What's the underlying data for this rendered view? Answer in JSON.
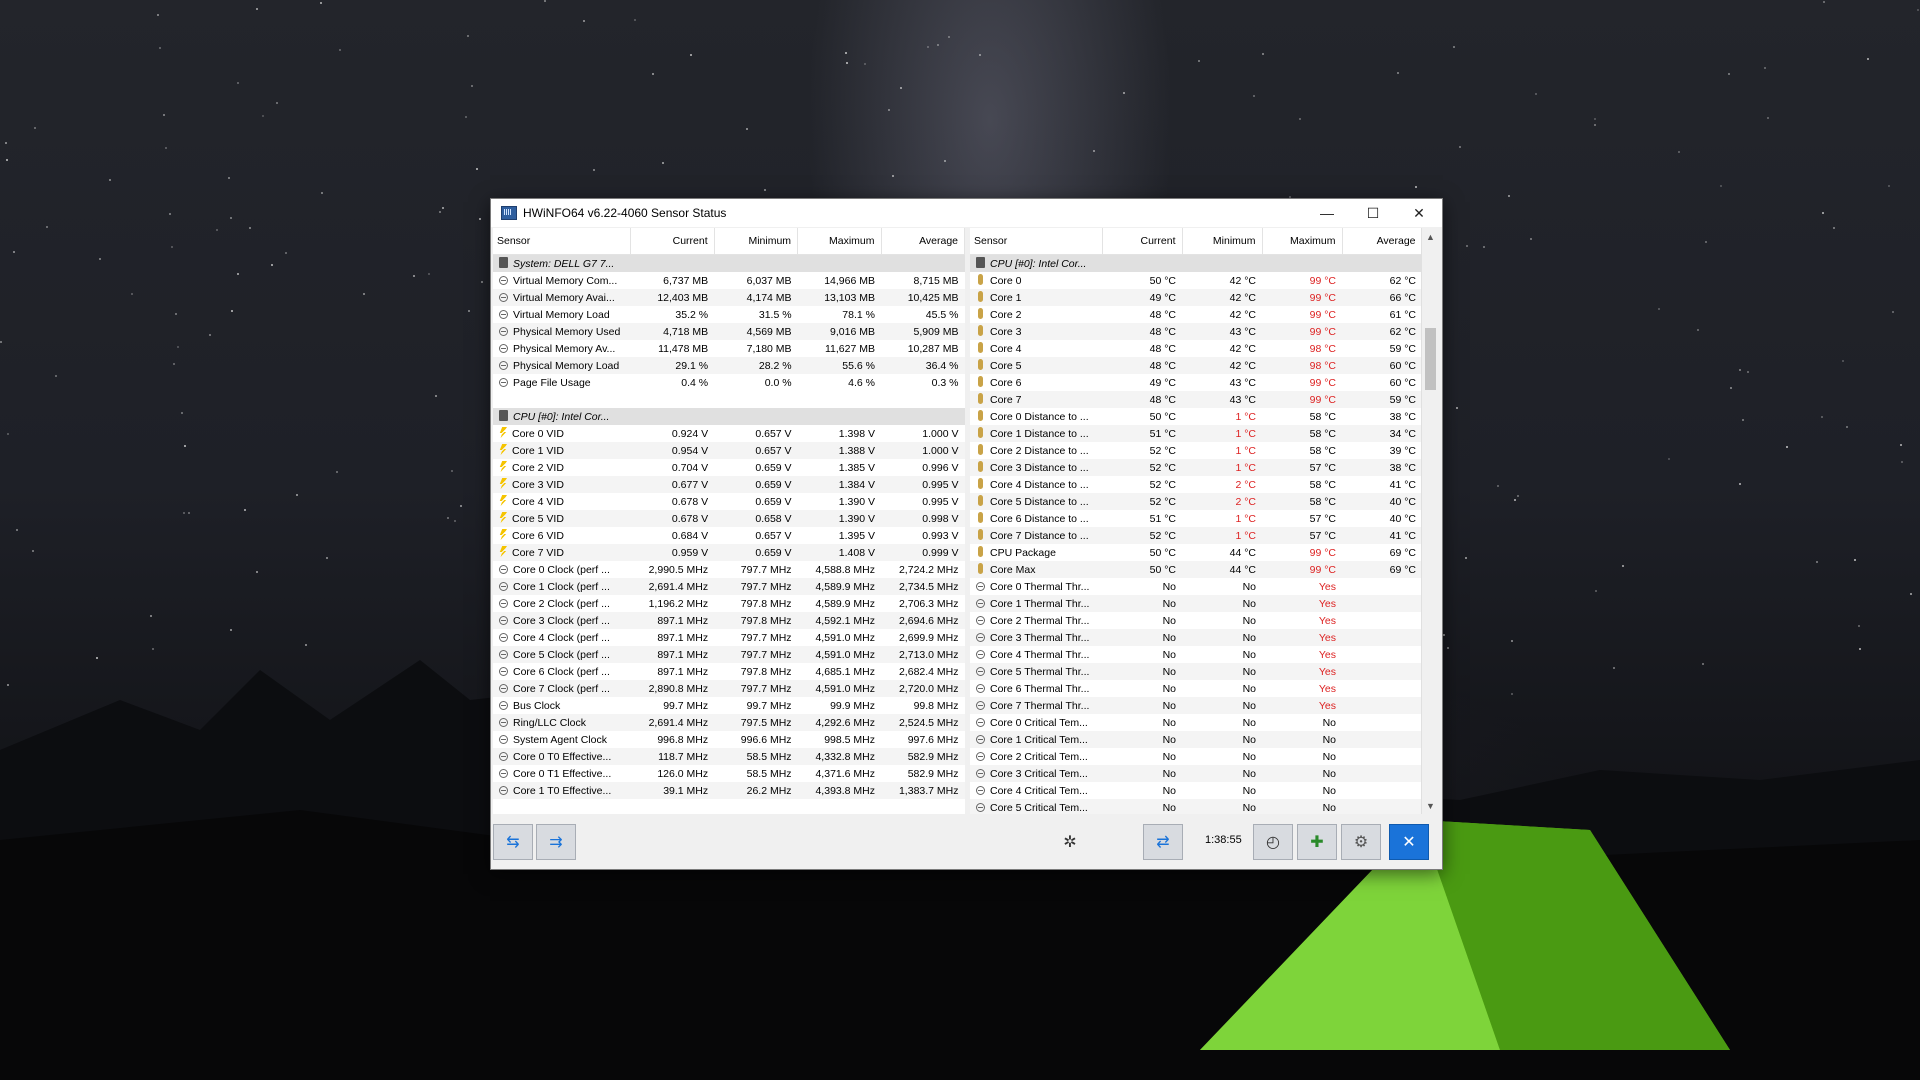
{
  "window": {
    "title": "HWiNFO64 v6.22-4060 Sensor Status",
    "minimize_glyph": "—",
    "maximize_glyph": "☐",
    "close_glyph": "✕"
  },
  "columns": [
    "Sensor",
    "Current",
    "Minimum",
    "Maximum",
    "Average"
  ],
  "left_rows": [
    {
      "type": "group",
      "icon": "chip-icon",
      "name": "System: DELL G7 7..."
    },
    {
      "type": "row",
      "icon": "circle-icon",
      "name": "Virtual Memory Com...",
      "cur": "6,737 MB",
      "min": "6,037 MB",
      "max": "14,966 MB",
      "avg": "8,715 MB"
    },
    {
      "type": "row",
      "icon": "circle-icon",
      "name": "Virtual Memory Avai...",
      "cur": "12,403 MB",
      "min": "4,174 MB",
      "max": "13,103 MB",
      "avg": "10,425 MB"
    },
    {
      "type": "row",
      "icon": "circle-icon",
      "name": "Virtual Memory Load",
      "cur": "35.2 %",
      "min": "31.5 %",
      "max": "78.1 %",
      "avg": "45.5 %"
    },
    {
      "type": "row",
      "icon": "circle-icon",
      "name": "Physical Memory Used",
      "cur": "4,718 MB",
      "min": "4,569 MB",
      "max": "9,016 MB",
      "avg": "5,909 MB"
    },
    {
      "type": "row",
      "icon": "circle-icon",
      "name": "Physical Memory Av...",
      "cur": "11,478 MB",
      "min": "7,180 MB",
      "max": "11,627 MB",
      "avg": "10,287 MB"
    },
    {
      "type": "row",
      "icon": "circle-icon",
      "name": "Physical Memory Load",
      "cur": "29.1 %",
      "min": "28.2 %",
      "max": "55.6 %",
      "avg": "36.4 %"
    },
    {
      "type": "row",
      "icon": "circle-icon",
      "name": "Page File Usage",
      "cur": "0.4 %",
      "min": "0.0 %",
      "max": "4.6 %",
      "avg": "0.3 %"
    },
    {
      "type": "blank"
    },
    {
      "type": "group",
      "icon": "chip-icon",
      "name": "CPU [#0]: Intel Cor..."
    },
    {
      "type": "row",
      "icon": "bolt-icon",
      "name": "Core 0 VID",
      "cur": "0.924 V",
      "min": "0.657 V",
      "max": "1.398 V",
      "avg": "1.000 V"
    },
    {
      "type": "row",
      "icon": "bolt-icon",
      "name": "Core 1 VID",
      "cur": "0.954 V",
      "min": "0.657 V",
      "max": "1.388 V",
      "avg": "1.000 V"
    },
    {
      "type": "row",
      "icon": "bolt-icon",
      "name": "Core 2 VID",
      "cur": "0.704 V",
      "min": "0.659 V",
      "max": "1.385 V",
      "avg": "0.996 V"
    },
    {
      "type": "row",
      "icon": "bolt-icon",
      "name": "Core 3 VID",
      "cur": "0.677 V",
      "min": "0.659 V",
      "max": "1.384 V",
      "avg": "0.995 V"
    },
    {
      "type": "row",
      "icon": "bolt-icon",
      "name": "Core 4 VID",
      "cur": "0.678 V",
      "min": "0.659 V",
      "max": "1.390 V",
      "avg": "0.995 V"
    },
    {
      "type": "row",
      "icon": "bolt-icon",
      "name": "Core 5 VID",
      "cur": "0.678 V",
      "min": "0.658 V",
      "max": "1.390 V",
      "avg": "0.998 V"
    },
    {
      "type": "row",
      "icon": "bolt-icon",
      "name": "Core 6 VID",
      "cur": "0.684 V",
      "min": "0.657 V",
      "max": "1.395 V",
      "avg": "0.993 V"
    },
    {
      "type": "row",
      "icon": "bolt-icon",
      "name": "Core 7 VID",
      "cur": "0.959 V",
      "min": "0.659 V",
      "max": "1.408 V",
      "avg": "0.999 V"
    },
    {
      "type": "row",
      "icon": "circle-icon",
      "name": "Core 0 Clock (perf ...",
      "cur": "2,990.5 MHz",
      "min": "797.7 MHz",
      "max": "4,588.8 MHz",
      "avg": "2,724.2 MHz"
    },
    {
      "type": "row",
      "icon": "circle-icon",
      "name": "Core 1 Clock (perf ...",
      "cur": "2,691.4 MHz",
      "min": "797.7 MHz",
      "max": "4,589.9 MHz",
      "avg": "2,734.5 MHz"
    },
    {
      "type": "row",
      "icon": "circle-icon",
      "name": "Core 2 Clock (perf ...",
      "cur": "1,196.2 MHz",
      "min": "797.8 MHz",
      "max": "4,589.9 MHz",
      "avg": "2,706.3 MHz"
    },
    {
      "type": "row",
      "icon": "circle-icon",
      "name": "Core 3 Clock (perf ...",
      "cur": "897.1 MHz",
      "min": "797.8 MHz",
      "max": "4,592.1 MHz",
      "avg": "2,694.6 MHz"
    },
    {
      "type": "row",
      "icon": "circle-icon",
      "name": "Core 4 Clock (perf ...",
      "cur": "897.1 MHz",
      "min": "797.7 MHz",
      "max": "4,591.0 MHz",
      "avg": "2,699.9 MHz"
    },
    {
      "type": "row",
      "icon": "circle-icon",
      "name": "Core 5 Clock (perf ...",
      "cur": "897.1 MHz",
      "min": "797.7 MHz",
      "max": "4,591.0 MHz",
      "avg": "2,713.0 MHz"
    },
    {
      "type": "row",
      "icon": "circle-icon",
      "name": "Core 6 Clock (perf ...",
      "cur": "897.1 MHz",
      "min": "797.8 MHz",
      "max": "4,685.1 MHz",
      "avg": "2,682.4 MHz"
    },
    {
      "type": "row",
      "icon": "circle-icon",
      "name": "Core 7 Clock (perf ...",
      "cur": "2,890.8 MHz",
      "min": "797.7 MHz",
      "max": "4,591.0 MHz",
      "avg": "2,720.0 MHz"
    },
    {
      "type": "row",
      "icon": "circle-icon",
      "name": "Bus Clock",
      "cur": "99.7 MHz",
      "min": "99.7 MHz",
      "max": "99.9 MHz",
      "avg": "99.8 MHz"
    },
    {
      "type": "row",
      "icon": "circle-icon",
      "name": "Ring/LLC Clock",
      "cur": "2,691.4 MHz",
      "min": "797.5 MHz",
      "max": "4,292.6 MHz",
      "avg": "2,524.5 MHz"
    },
    {
      "type": "row",
      "icon": "circle-icon",
      "name": "System Agent Clock",
      "cur": "996.8 MHz",
      "min": "996.6 MHz",
      "max": "998.5 MHz",
      "avg": "997.6 MHz"
    },
    {
      "type": "row",
      "icon": "circle-icon",
      "name": "Core 0 T0 Effective...",
      "cur": "118.7 MHz",
      "min": "58.5 MHz",
      "max": "4,332.8 MHz",
      "avg": "582.9 MHz"
    },
    {
      "type": "row",
      "icon": "circle-icon",
      "name": "Core 0 T1 Effective...",
      "cur": "126.0 MHz",
      "min": "58.5 MHz",
      "max": "4,371.6 MHz",
      "avg": "582.9 MHz"
    },
    {
      "type": "row",
      "icon": "circle-icon",
      "name": "Core 1 T0 Effective...",
      "cur": "39.1 MHz",
      "min": "26.2 MHz",
      "max": "4,393.8 MHz",
      "avg": "1,383.7 MHz"
    }
  ],
  "right_rows": [
    {
      "type": "group",
      "icon": "chip-icon",
      "name": "CPU [#0]: Intel Cor..."
    },
    {
      "type": "row",
      "icon": "thermometer-icon",
      "name": "Core 0",
      "cur": "50 °C",
      "min": "42 °C",
      "max": "99 °C",
      "avg": "62 °C",
      "red": [
        "max"
      ]
    },
    {
      "type": "row",
      "icon": "thermometer-icon",
      "name": "Core 1",
      "cur": "49 °C",
      "min": "42 °C",
      "max": "99 °C",
      "avg": "66 °C",
      "red": [
        "max"
      ]
    },
    {
      "type": "row",
      "icon": "thermometer-icon",
      "name": "Core 2",
      "cur": "48 °C",
      "min": "42 °C",
      "max": "99 °C",
      "avg": "61 °C",
      "red": [
        "max"
      ]
    },
    {
      "type": "row",
      "icon": "thermometer-icon",
      "name": "Core 3",
      "cur": "48 °C",
      "min": "43 °C",
      "max": "99 °C",
      "avg": "62 °C",
      "red": [
        "max"
      ]
    },
    {
      "type": "row",
      "icon": "thermometer-icon",
      "name": "Core 4",
      "cur": "48 °C",
      "min": "42 °C",
      "max": "98 °C",
      "avg": "59 °C",
      "red": [
        "max"
      ]
    },
    {
      "type": "row",
      "icon": "thermometer-icon",
      "name": "Core 5",
      "cur": "48 °C",
      "min": "42 °C",
      "max": "98 °C",
      "avg": "60 °C",
      "red": [
        "max"
      ]
    },
    {
      "type": "row",
      "icon": "thermometer-icon",
      "name": "Core 6",
      "cur": "49 °C",
      "min": "43 °C",
      "max": "99 °C",
      "avg": "60 °C",
      "red": [
        "max"
      ]
    },
    {
      "type": "row",
      "icon": "thermometer-icon",
      "name": "Core 7",
      "cur": "48 °C",
      "min": "43 °C",
      "max": "99 °C",
      "avg": "59 °C",
      "red": [
        "max"
      ]
    },
    {
      "type": "row",
      "icon": "thermometer-icon",
      "name": "Core 0 Distance to ...",
      "cur": "50 °C",
      "min": "1 °C",
      "max": "58 °C",
      "avg": "38 °C",
      "red": [
        "min"
      ]
    },
    {
      "type": "row",
      "icon": "thermometer-icon",
      "name": "Core 1 Distance to ...",
      "cur": "51 °C",
      "min": "1 °C",
      "max": "58 °C",
      "avg": "34 °C",
      "red": [
        "min"
      ]
    },
    {
      "type": "row",
      "icon": "thermometer-icon",
      "name": "Core 2 Distance to ...",
      "cur": "52 °C",
      "min": "1 °C",
      "max": "58 °C",
      "avg": "39 °C",
      "red": [
        "min"
      ]
    },
    {
      "type": "row",
      "icon": "thermometer-icon",
      "name": "Core 3 Distance to ...",
      "cur": "52 °C",
      "min": "1 °C",
      "max": "57 °C",
      "avg": "38 °C",
      "red": [
        "min"
      ]
    },
    {
      "type": "row",
      "icon": "thermometer-icon",
      "name": "Core 4 Distance to ...",
      "cur": "52 °C",
      "min": "2 °C",
      "max": "58 °C",
      "avg": "41 °C",
      "red": [
        "min"
      ]
    },
    {
      "type": "row",
      "icon": "thermometer-icon",
      "name": "Core 5 Distance to ...",
      "cur": "52 °C",
      "min": "2 °C",
      "max": "58 °C",
      "avg": "40 °C",
      "red": [
        "min"
      ]
    },
    {
      "type": "row",
      "icon": "thermometer-icon",
      "name": "Core 6 Distance to ...",
      "cur": "51 °C",
      "min": "1 °C",
      "max": "57 °C",
      "avg": "40 °C",
      "red": [
        "min"
      ]
    },
    {
      "type": "row",
      "icon": "thermometer-icon",
      "name": "Core 7 Distance to ...",
      "cur": "52 °C",
      "min": "1 °C",
      "max": "57 °C",
      "avg": "41 °C",
      "red": [
        "min"
      ]
    },
    {
      "type": "row",
      "icon": "thermometer-icon",
      "name": "CPU Package",
      "cur": "50 °C",
      "min": "44 °C",
      "max": "99 °C",
      "avg": "69 °C",
      "red": [
        "max"
      ]
    },
    {
      "type": "row",
      "icon": "thermometer-icon",
      "name": "Core Max",
      "cur": "50 °C",
      "min": "44 °C",
      "max": "99 °C",
      "avg": "69 °C",
      "red": [
        "max"
      ]
    },
    {
      "type": "row",
      "icon": "circle-icon",
      "name": "Core 0 Thermal Thr...",
      "cur": "No",
      "min": "No",
      "max": "Yes",
      "avg": "",
      "red": [
        "max"
      ]
    },
    {
      "type": "row",
      "icon": "circle-icon",
      "name": "Core 1 Thermal Thr...",
      "cur": "No",
      "min": "No",
      "max": "Yes",
      "avg": "",
      "red": [
        "max"
      ]
    },
    {
      "type": "row",
      "icon": "circle-icon",
      "name": "Core 2 Thermal Thr...",
      "cur": "No",
      "min": "No",
      "max": "Yes",
      "avg": "",
      "red": [
        "max"
      ]
    },
    {
      "type": "row",
      "icon": "circle-icon",
      "name": "Core 3 Thermal Thr...",
      "cur": "No",
      "min": "No",
      "max": "Yes",
      "avg": "",
      "red": [
        "max"
      ]
    },
    {
      "type": "row",
      "icon": "circle-icon",
      "name": "Core 4 Thermal Thr...",
      "cur": "No",
      "min": "No",
      "max": "Yes",
      "avg": "",
      "red": [
        "max"
      ]
    },
    {
      "type": "row",
      "icon": "circle-icon",
      "name": "Core 5 Thermal Thr...",
      "cur": "No",
      "min": "No",
      "max": "Yes",
      "avg": "",
      "red": [
        "max"
      ]
    },
    {
      "type": "row",
      "icon": "circle-icon",
      "name": "Core 6 Thermal Thr...",
      "cur": "No",
      "min": "No",
      "max": "Yes",
      "avg": "",
      "red": [
        "max"
      ]
    },
    {
      "type": "row",
      "icon": "circle-icon",
      "name": "Core 7 Thermal Thr...",
      "cur": "No",
      "min": "No",
      "max": "Yes",
      "avg": "",
      "red": [
        "max"
      ]
    },
    {
      "type": "row",
      "icon": "circle-icon",
      "name": "Core 0 Critical Tem...",
      "cur": "No",
      "min": "No",
      "max": "No",
      "avg": ""
    },
    {
      "type": "row",
      "icon": "circle-icon",
      "name": "Core 1 Critical Tem...",
      "cur": "No",
      "min": "No",
      "max": "No",
      "avg": ""
    },
    {
      "type": "row",
      "icon": "circle-icon",
      "name": "Core 2 Critical Tem...",
      "cur": "No",
      "min": "No",
      "max": "No",
      "avg": ""
    },
    {
      "type": "row",
      "icon": "circle-icon",
      "name": "Core 3 Critical Tem...",
      "cur": "No",
      "min": "No",
      "max": "No",
      "avg": ""
    },
    {
      "type": "row",
      "icon": "circle-icon",
      "name": "Core 4 Critical Tem...",
      "cur": "No",
      "min": "No",
      "max": "No",
      "avg": ""
    },
    {
      "type": "row",
      "icon": "circle-icon",
      "name": "Core 5 Critical Tem...",
      "cur": "No",
      "min": "No",
      "max": "No",
      "avg": ""
    }
  ],
  "footer": {
    "timer": "1:38:55",
    "nav_left_glyph": "⇆",
    "nav_right_glyph": "⇉",
    "close_glyph": "✕"
  },
  "colors": {
    "alert_red": "#d22222",
    "accent_blue": "#1a73d9"
  }
}
